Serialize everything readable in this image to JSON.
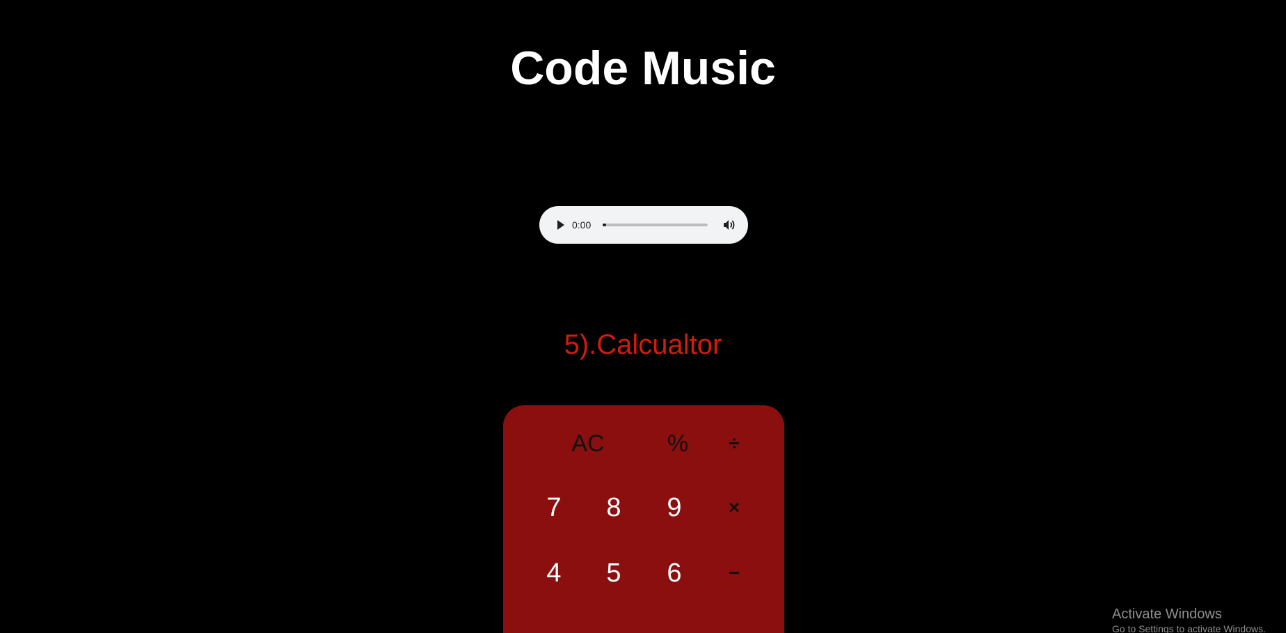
{
  "page": {
    "title": "Code Music",
    "background": "#000000"
  },
  "audio": {
    "current_time": "0:00",
    "progress_fraction": 0.03,
    "play_icon": "play-icon",
    "volume_icon": "volume-icon",
    "background": "#f1f3f4"
  },
  "section": {
    "heading": "5).Calcualtor",
    "heading_color": "#d11d0b"
  },
  "calculator": {
    "background": "#8b0f0f",
    "rows": [
      [
        {
          "label": "AC",
          "kind": "func",
          "name": "clear-button"
        },
        {
          "label": "%",
          "kind": "func",
          "name": "percent-button"
        },
        {
          "label": "÷",
          "kind": "op",
          "name": "divide-button"
        }
      ],
      [
        {
          "label": "7",
          "kind": "digit",
          "name": "digit-7-button"
        },
        {
          "label": "8",
          "kind": "digit",
          "name": "digit-8-button"
        },
        {
          "label": "9",
          "kind": "digit",
          "name": "digit-9-button"
        },
        {
          "label": "×",
          "kind": "op",
          "name": "multiply-button"
        }
      ],
      [
        {
          "label": "4",
          "kind": "digit",
          "name": "digit-4-button"
        },
        {
          "label": "5",
          "kind": "digit",
          "name": "digit-5-button"
        },
        {
          "label": "6",
          "kind": "digit",
          "name": "digit-6-button"
        },
        {
          "label": "−",
          "kind": "op",
          "name": "subtract-button"
        }
      ]
    ]
  },
  "watermark": {
    "title": "Activate Windows",
    "subtitle": "Go to Settings to activate Windows."
  }
}
